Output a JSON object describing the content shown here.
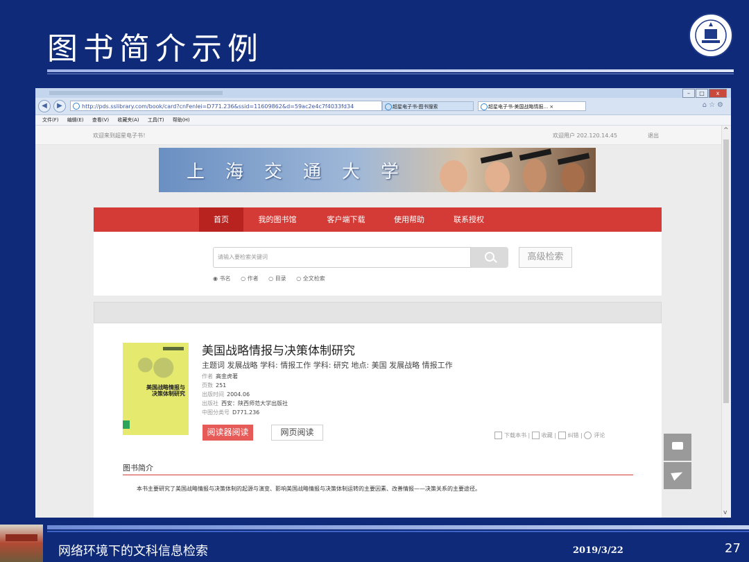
{
  "slide": {
    "title": "图书简介示例",
    "footer_title": "网络环境下的文科信息检索",
    "footer_date": "2019/3/22",
    "page_number": "27"
  },
  "browser": {
    "url": "http://pds.sslibrary.com/book/card?cnFenlei=D771.236&ssid=11609862&d=59ac2e4c7f4033fd34",
    "tabs": [
      "超星电子书-图书搜索",
      "超星电子书-美国战略情报... ×"
    ],
    "menu": [
      "文件(F)",
      "编辑(E)",
      "查看(V)",
      "收藏夹(A)",
      "工具(T)",
      "帮助(H)"
    ]
  },
  "site": {
    "welcome": "欢迎来到超星电子书！",
    "user_text": "欢迎用户 202.120.14.45",
    "logout": "退出",
    "banner_text": "上海交通大学",
    "nav": [
      "首页",
      "我的图书馆",
      "客户端下载",
      "使用帮助",
      "联系授权"
    ],
    "search_placeholder": "请输入要检索关键词",
    "advanced_search": "高级检索",
    "radio_options": [
      "书名",
      "作者",
      "目录",
      "全文检索"
    ]
  },
  "book": {
    "title": "美国战略情报与决策体制研究",
    "keywords": "主题词 发展战略 学科: 情报工作 学科: 研究 地点: 美国 发展战略 情报工作",
    "author_label": "作者",
    "author": "高金虎著",
    "pages_label": "页数",
    "pages": "251",
    "date_label": "出版时间",
    "date": "2004.06",
    "publisher_label": "出版社",
    "publisher": "西安：陕西师范大学出版社",
    "class_label": "中图分类号",
    "class_no": "D771.236",
    "cover_text": "美国战略情报与决策体制研究",
    "read_button": "阅读器阅读",
    "web_button": "网页阅读",
    "actions": [
      "下载本书",
      "收藏",
      "纠错",
      "评论"
    ]
  },
  "intro": {
    "heading": "图书简介",
    "text": "本书主要研究了美国战略情报与决策体制的起源与演变、影响美国战略情报与决策体制运转的主要因素、改善情报——决策关系的主要途径。"
  },
  "colors": {
    "slide_bg": "#0e2a78",
    "nav_red": "#d43a36",
    "read_button": "#e65a57"
  }
}
